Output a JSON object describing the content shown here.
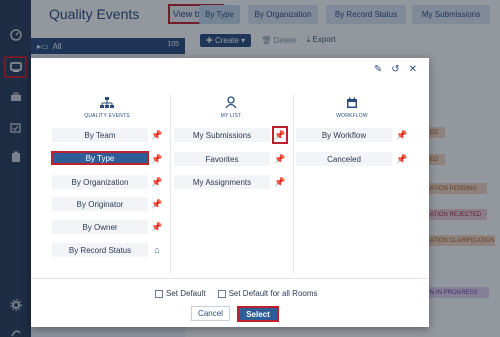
{
  "header": {
    "title": "Quality Events",
    "view_by_label": "View by",
    "tabs": [
      "By Type",
      "By Organization",
      "By Record Status",
      "My Submissions"
    ]
  },
  "tree": {
    "all_label": "All",
    "all_count": "105"
  },
  "toolbar": {
    "create": "Create",
    "delete": "Delete",
    "export": "Export"
  },
  "background_statuses": [
    "ED",
    "ED",
    "ATION PENDING",
    "ATION REJECTED",
    "ATION CLARIFICATION",
    "N IN PROGRESS"
  ],
  "modal": {
    "columns": [
      {
        "heading": "QUALITY EVENTS",
        "icon": "hierarchy-icon",
        "items": [
          {
            "label": "By Team",
            "pin": "off"
          },
          {
            "label": "By Type",
            "pin": "on",
            "selected": true
          },
          {
            "label": "By Organization",
            "pin": "on"
          },
          {
            "label": "By Originator",
            "pin": "off"
          },
          {
            "label": "By Owner",
            "pin": "off"
          },
          {
            "label": "By Record Status",
            "pin": "home"
          }
        ]
      },
      {
        "heading": "MY LIST",
        "icon": "user-icon",
        "items": [
          {
            "label": "My Submissions",
            "pin": "on"
          },
          {
            "label": "Favorites",
            "pin": "off"
          },
          {
            "label": "My Assignments",
            "pin": "on"
          }
        ]
      },
      {
        "heading": "WORKFLOW",
        "icon": "calendar-icon",
        "items": [
          {
            "label": "By Workflow",
            "pin": "on"
          },
          {
            "label": "Canceled",
            "pin": "off"
          }
        ]
      }
    ],
    "set_default": "Set Default",
    "set_default_all": "Set Default for all Rooms",
    "cancel": "Cancel",
    "select": "Select"
  },
  "colors": {
    "accent": "#2f5d97",
    "highlight": "#c0202b",
    "pin_on": "#e8a31a",
    "rail": "#2b3f5c"
  }
}
